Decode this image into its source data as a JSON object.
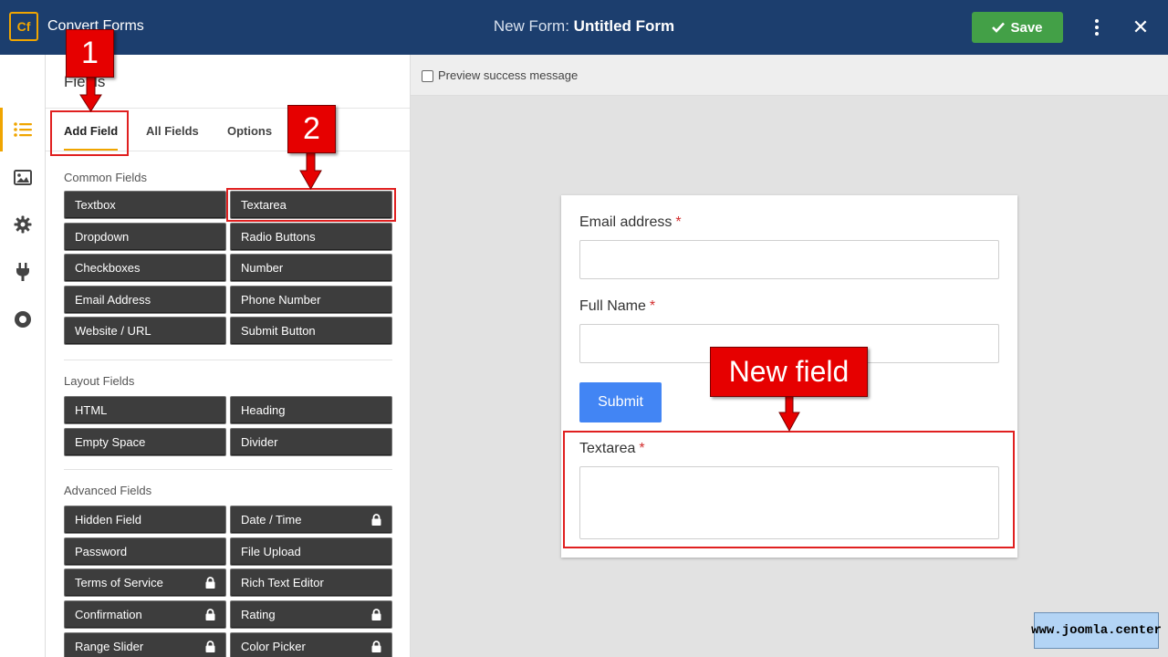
{
  "topbar": {
    "logo_text": "Cf",
    "app_name": "Convert Forms",
    "form_title_prefix": "New Form:",
    "form_title": "Untitled Form",
    "save_label": "Save",
    "icons": [
      "check-icon",
      "kebab-menu-icon",
      "close-icon"
    ]
  },
  "rail": {
    "items": [
      {
        "icon": "list-icon",
        "active": true
      },
      {
        "icon": "image-icon",
        "active": false
      },
      {
        "icon": "gear-icon",
        "active": false
      },
      {
        "icon": "plug-icon",
        "active": false
      },
      {
        "icon": "circle-dot-icon",
        "active": false
      }
    ],
    "accent": "#f0a500"
  },
  "panel": {
    "title": "Fields",
    "tabs": [
      {
        "label": "Add Field",
        "active": true
      },
      {
        "label": "All Fields",
        "active": false
      },
      {
        "label": "Options",
        "active": false
      }
    ],
    "common": {
      "label": "Common Fields",
      "fields": [
        {
          "label": "Textbox",
          "locked": false
        },
        {
          "label": "Textarea",
          "locked": false
        },
        {
          "label": "Dropdown",
          "locked": false
        },
        {
          "label": "Radio Buttons",
          "locked": false
        },
        {
          "label": "Checkboxes",
          "locked": false
        },
        {
          "label": "Number",
          "locked": false
        },
        {
          "label": "Email Address",
          "locked": false
        },
        {
          "label": "Phone Number",
          "locked": false
        },
        {
          "label": "Website / URL",
          "locked": false
        },
        {
          "label": "Submit Button",
          "locked": false
        }
      ]
    },
    "layout": {
      "label": "Layout Fields",
      "fields": [
        {
          "label": "HTML",
          "locked": false
        },
        {
          "label": "Heading",
          "locked": false
        },
        {
          "label": "Empty Space",
          "locked": false
        },
        {
          "label": "Divider",
          "locked": false
        }
      ]
    },
    "advanced": {
      "label": "Advanced Fields",
      "fields": [
        {
          "label": "Hidden Field",
          "locked": false
        },
        {
          "label": "Date / Time",
          "locked": true
        },
        {
          "label": "Password",
          "locked": false
        },
        {
          "label": "File Upload",
          "locked": false
        },
        {
          "label": "Terms of Service",
          "locked": true
        },
        {
          "label": "Rich Text Editor",
          "locked": false
        },
        {
          "label": "Confirmation",
          "locked": true
        },
        {
          "label": "Rating",
          "locked": true
        },
        {
          "label": "Range Slider",
          "locked": true
        },
        {
          "label": "Color Picker",
          "locked": true
        }
      ]
    }
  },
  "canvas": {
    "preview_label": "Preview success message",
    "preview_checked": false,
    "form": {
      "fields": [
        {
          "label": "Email address",
          "required_mark": "*"
        },
        {
          "label": "Full Name",
          "required_mark": "*"
        }
      ],
      "submit_label": "Submit",
      "new_field": {
        "label": "Textarea",
        "required_mark": "*"
      }
    }
  },
  "annotations": {
    "callout_1": "1",
    "callout_2": "2",
    "callout_new": "New field",
    "color": "#e60000"
  },
  "watermark": "www.joomla.center",
  "colors": {
    "topbar": "#1c3e6e",
    "save": "#43a047",
    "submit": "#4285f4",
    "field_button": "#3d3d3d",
    "required": "#d32f2f"
  }
}
